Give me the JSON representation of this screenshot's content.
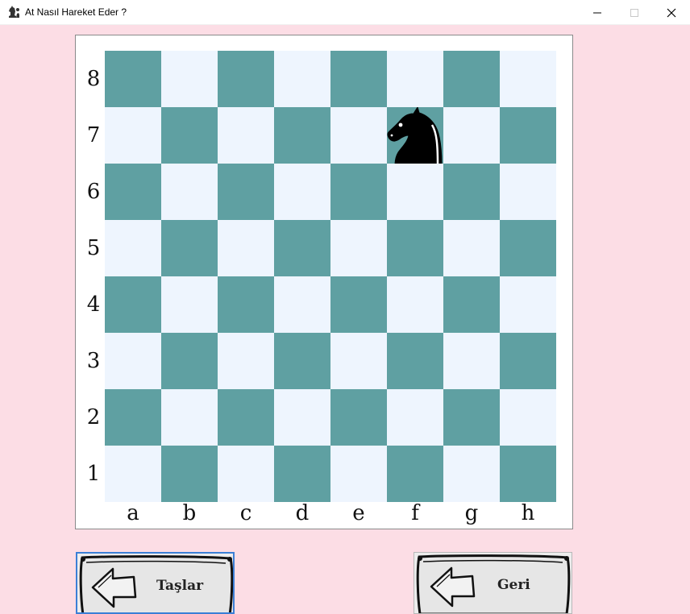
{
  "window": {
    "title": "At Nasıl Hareket Eder ?",
    "icon": "knight-icon"
  },
  "colors": {
    "background": "#fcdde5",
    "dark_square": "#5fa0a2",
    "light_square": "#eef5fe"
  },
  "board": {
    "ranks": [
      "8",
      "7",
      "6",
      "5",
      "4",
      "3",
      "2",
      "1"
    ],
    "files": [
      "a",
      "b",
      "c",
      "d",
      "e",
      "f",
      "g",
      "h"
    ],
    "piece": {
      "type": "knight",
      "color": "black",
      "square": "f7"
    }
  },
  "buttons": {
    "pieces_label": "Taşlar",
    "back_label": "Geri"
  }
}
